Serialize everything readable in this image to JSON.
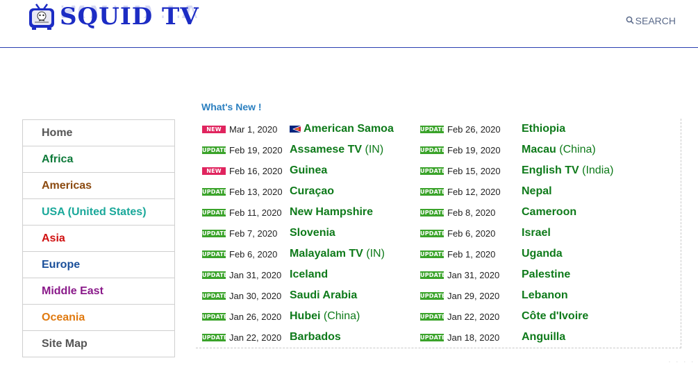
{
  "header": {
    "logo_text": "SQUID TV",
    "search_label": "SEARCH"
  },
  "colors": {
    "brand_blue": "#1c2cc4",
    "link_green": "#0e7a1a",
    "new_badge": "#e0245e",
    "update_badge": "#3aa32a",
    "whats_new_title": "#2a7fc0"
  },
  "main": {
    "title": "What's New !"
  },
  "sidebar": {
    "items": [
      {
        "label": "Home",
        "color": "#555555"
      },
      {
        "label": "Africa",
        "color": "#0e7a3a"
      },
      {
        "label": "Americas",
        "color": "#8b4a10"
      },
      {
        "label": "USA (United States)",
        "color": "#1aa89a"
      },
      {
        "label": "Asia",
        "color": "#d01010"
      },
      {
        "label": "Europe",
        "color": "#1a4f9a"
      },
      {
        "label": "Middle East",
        "color": "#8a1a8a"
      },
      {
        "label": "Oceania",
        "color": "#e07a10"
      },
      {
        "label": "Site Map",
        "color": "#555555"
      }
    ]
  },
  "updates": {
    "left": [
      {
        "badge": "NEW",
        "date": "Mar 1, 2020",
        "name": "American Samoa",
        "suffix": "",
        "flag": "american-samoa-flag"
      },
      {
        "badge": "UPDATE",
        "date": "Feb 19, 2020",
        "name": "Assamese TV",
        "suffix": " (IN)"
      },
      {
        "badge": "NEW",
        "date": "Feb 16, 2020",
        "name": "Guinea",
        "suffix": ""
      },
      {
        "badge": "UPDATE",
        "date": "Feb 13, 2020",
        "name": "Curaçao",
        "suffix": ""
      },
      {
        "badge": "UPDATE",
        "date": "Feb 11, 2020",
        "name": "New Hampshire",
        "suffix": ""
      },
      {
        "badge": "UPDATE",
        "date": "Feb 7, 2020",
        "name": "Slovenia",
        "suffix": ""
      },
      {
        "badge": "UPDATE",
        "date": "Feb 6, 2020",
        "name": "Malayalam TV",
        "suffix": " (IN)"
      },
      {
        "badge": "UPDATE",
        "date": "Jan 31, 2020",
        "name": "Iceland",
        "suffix": ""
      },
      {
        "badge": "UPDATE",
        "date": "Jan 30, 2020",
        "name": "Saudi Arabia",
        "suffix": ""
      },
      {
        "badge": "UPDATE",
        "date": "Jan 26, 2020",
        "name": "Hubei",
        "suffix": " (China)"
      },
      {
        "badge": "UPDATE",
        "date": "Jan 22, 2020",
        "name": "Barbados",
        "suffix": ""
      }
    ],
    "right": [
      {
        "badge": "UPDATE",
        "date": "Feb 26, 2020",
        "name": "Ethiopia",
        "suffix": ""
      },
      {
        "badge": "UPDATE",
        "date": "Feb 19, 2020",
        "name": "Macau",
        "suffix": " (China)"
      },
      {
        "badge": "UPDATE",
        "date": "Feb 15, 2020",
        "name": "English TV",
        "suffix": " (India)"
      },
      {
        "badge": "UPDATE",
        "date": "Feb 12, 2020",
        "name": "Nepal",
        "suffix": ""
      },
      {
        "badge": "UPDATE",
        "date": "Feb 8, 2020",
        "name": "Cameroon",
        "suffix": ""
      },
      {
        "badge": "UPDATE",
        "date": "Feb 6, 2020",
        "name": "Israel",
        "suffix": ""
      },
      {
        "badge": "UPDATE",
        "date": "Feb 1, 2020",
        "name": "Uganda",
        "suffix": ""
      },
      {
        "badge": "UPDATE",
        "date": "Jan 31, 2020",
        "name": "Palestine",
        "suffix": ""
      },
      {
        "badge": "UPDATE",
        "date": "Jan 29, 2020",
        "name": "Lebanon",
        "suffix": ""
      },
      {
        "badge": "UPDATE",
        "date": "Jan 22, 2020",
        "name": "Côte d'Ivoire",
        "suffix": ""
      },
      {
        "badge": "UPDATE",
        "date": "Jan 18, 2020",
        "name": "Anguilla",
        "suffix": ""
      }
    ]
  }
}
